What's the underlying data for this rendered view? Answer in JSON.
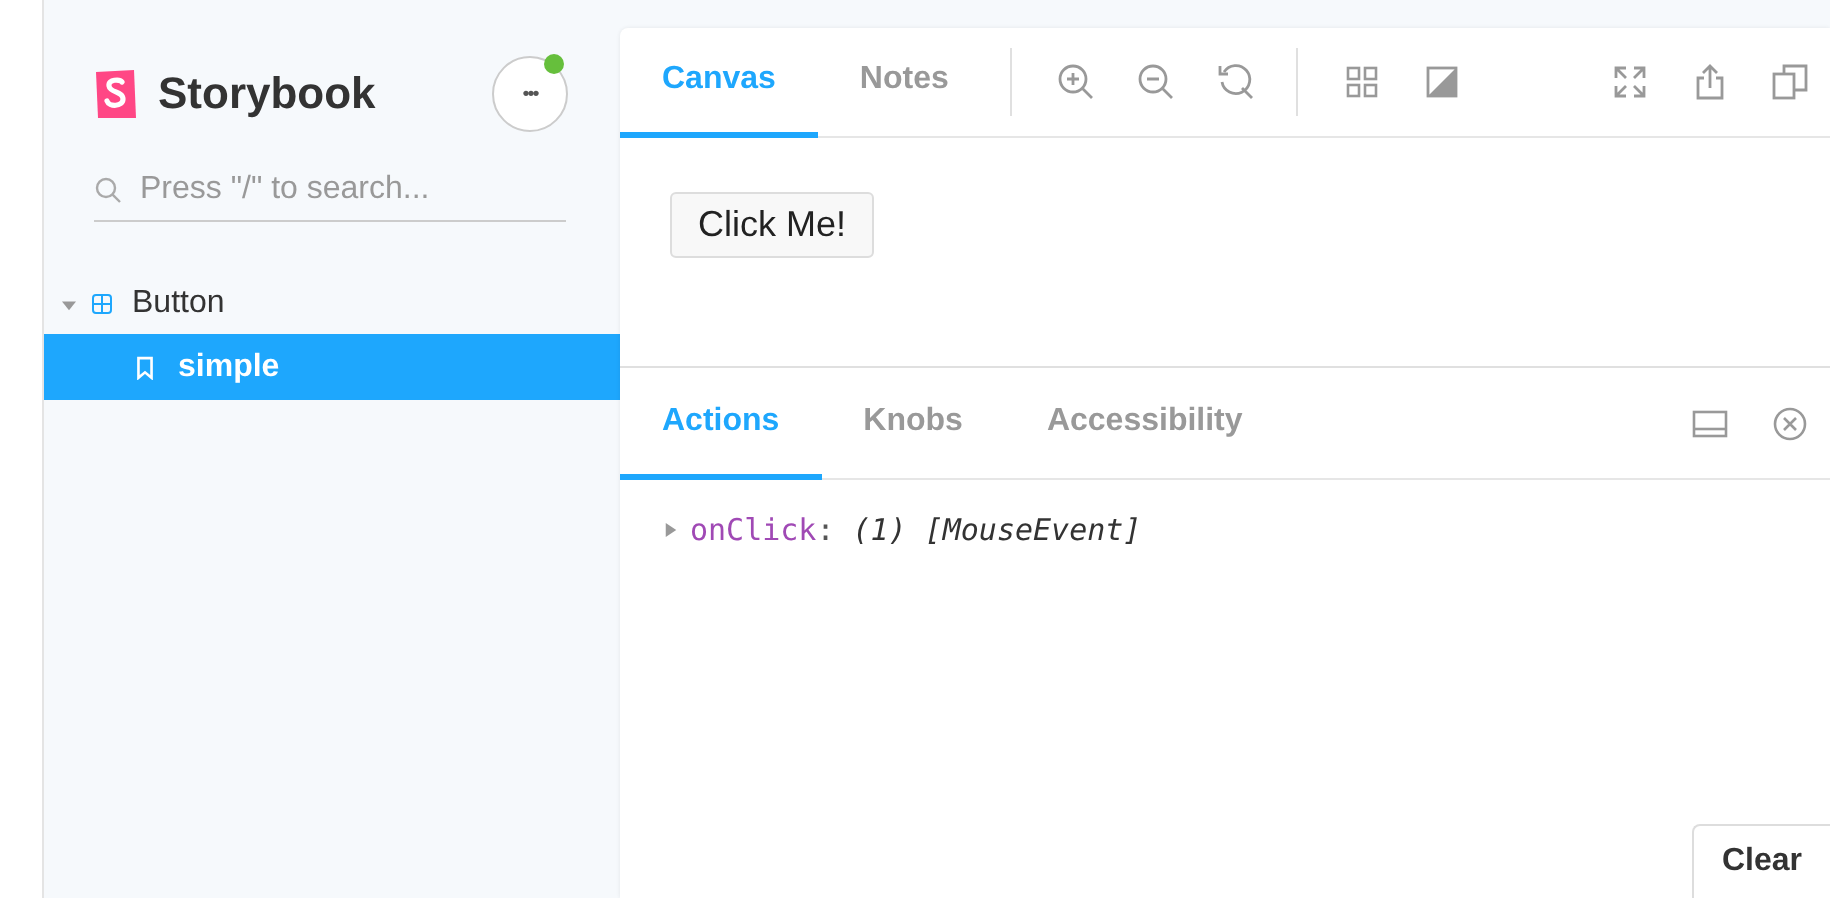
{
  "sidebar": {
    "brand": "Storybook",
    "menu_button": {
      "label": "•••",
      "notification": true
    },
    "search": {
      "placeholder": "Press \"/\" to search..."
    },
    "tree": [
      {
        "label": "Button",
        "kind": "component",
        "expanded": true,
        "selected": false,
        "children": [
          {
            "label": "simple",
            "kind": "story",
            "selected": true
          }
        ]
      }
    ]
  },
  "toolbar": {
    "tabs": [
      {
        "label": "Canvas",
        "selected": true
      },
      {
        "label": "Notes",
        "selected": false
      }
    ]
  },
  "preview": {
    "button": "Click Me!"
  },
  "addons": {
    "tabs": [
      {
        "label": "Actions",
        "selected": true
      },
      {
        "label": "Knobs",
        "selected": false
      },
      {
        "label": "Accessibility",
        "selected": false
      }
    ],
    "actions": [
      {
        "name": "onClick",
        "separator": ":",
        "count": "(1)",
        "value": "[MouseEvent]",
        "expanded": false
      }
    ],
    "clear_button": "Clear"
  }
}
